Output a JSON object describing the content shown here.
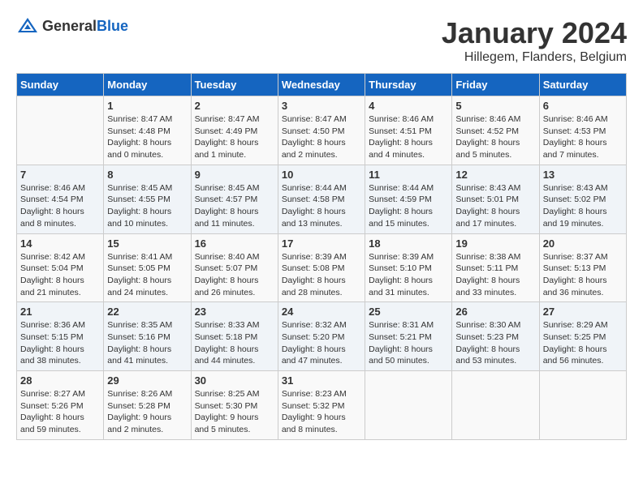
{
  "header": {
    "logo_general": "General",
    "logo_blue": "Blue",
    "title": "January 2024",
    "subtitle": "Hillegem, Flanders, Belgium"
  },
  "columns": [
    "Sunday",
    "Monday",
    "Tuesday",
    "Wednesday",
    "Thursday",
    "Friday",
    "Saturday"
  ],
  "weeks": [
    [
      {
        "day": "",
        "info": ""
      },
      {
        "day": "1",
        "info": "Sunrise: 8:47 AM\nSunset: 4:48 PM\nDaylight: 8 hours\nand 0 minutes."
      },
      {
        "day": "2",
        "info": "Sunrise: 8:47 AM\nSunset: 4:49 PM\nDaylight: 8 hours\nand 1 minute."
      },
      {
        "day": "3",
        "info": "Sunrise: 8:47 AM\nSunset: 4:50 PM\nDaylight: 8 hours\nand 2 minutes."
      },
      {
        "day": "4",
        "info": "Sunrise: 8:46 AM\nSunset: 4:51 PM\nDaylight: 8 hours\nand 4 minutes."
      },
      {
        "day": "5",
        "info": "Sunrise: 8:46 AM\nSunset: 4:52 PM\nDaylight: 8 hours\nand 5 minutes."
      },
      {
        "day": "6",
        "info": "Sunrise: 8:46 AM\nSunset: 4:53 PM\nDaylight: 8 hours\nand 7 minutes."
      }
    ],
    [
      {
        "day": "7",
        "info": "Sunrise: 8:46 AM\nSunset: 4:54 PM\nDaylight: 8 hours\nand 8 minutes."
      },
      {
        "day": "8",
        "info": "Sunrise: 8:45 AM\nSunset: 4:55 PM\nDaylight: 8 hours\nand 10 minutes."
      },
      {
        "day": "9",
        "info": "Sunrise: 8:45 AM\nSunset: 4:57 PM\nDaylight: 8 hours\nand 11 minutes."
      },
      {
        "day": "10",
        "info": "Sunrise: 8:44 AM\nSunset: 4:58 PM\nDaylight: 8 hours\nand 13 minutes."
      },
      {
        "day": "11",
        "info": "Sunrise: 8:44 AM\nSunset: 4:59 PM\nDaylight: 8 hours\nand 15 minutes."
      },
      {
        "day": "12",
        "info": "Sunrise: 8:43 AM\nSunset: 5:01 PM\nDaylight: 8 hours\nand 17 minutes."
      },
      {
        "day": "13",
        "info": "Sunrise: 8:43 AM\nSunset: 5:02 PM\nDaylight: 8 hours\nand 19 minutes."
      }
    ],
    [
      {
        "day": "14",
        "info": "Sunrise: 8:42 AM\nSunset: 5:04 PM\nDaylight: 8 hours\nand 21 minutes."
      },
      {
        "day": "15",
        "info": "Sunrise: 8:41 AM\nSunset: 5:05 PM\nDaylight: 8 hours\nand 24 minutes."
      },
      {
        "day": "16",
        "info": "Sunrise: 8:40 AM\nSunset: 5:07 PM\nDaylight: 8 hours\nand 26 minutes."
      },
      {
        "day": "17",
        "info": "Sunrise: 8:39 AM\nSunset: 5:08 PM\nDaylight: 8 hours\nand 28 minutes."
      },
      {
        "day": "18",
        "info": "Sunrise: 8:39 AM\nSunset: 5:10 PM\nDaylight: 8 hours\nand 31 minutes."
      },
      {
        "day": "19",
        "info": "Sunrise: 8:38 AM\nSunset: 5:11 PM\nDaylight: 8 hours\nand 33 minutes."
      },
      {
        "day": "20",
        "info": "Sunrise: 8:37 AM\nSunset: 5:13 PM\nDaylight: 8 hours\nand 36 minutes."
      }
    ],
    [
      {
        "day": "21",
        "info": "Sunrise: 8:36 AM\nSunset: 5:15 PM\nDaylight: 8 hours\nand 38 minutes."
      },
      {
        "day": "22",
        "info": "Sunrise: 8:35 AM\nSunset: 5:16 PM\nDaylight: 8 hours\nand 41 minutes."
      },
      {
        "day": "23",
        "info": "Sunrise: 8:33 AM\nSunset: 5:18 PM\nDaylight: 8 hours\nand 44 minutes."
      },
      {
        "day": "24",
        "info": "Sunrise: 8:32 AM\nSunset: 5:20 PM\nDaylight: 8 hours\nand 47 minutes."
      },
      {
        "day": "25",
        "info": "Sunrise: 8:31 AM\nSunset: 5:21 PM\nDaylight: 8 hours\nand 50 minutes."
      },
      {
        "day": "26",
        "info": "Sunrise: 8:30 AM\nSunset: 5:23 PM\nDaylight: 8 hours\nand 53 minutes."
      },
      {
        "day": "27",
        "info": "Sunrise: 8:29 AM\nSunset: 5:25 PM\nDaylight: 8 hours\nand 56 minutes."
      }
    ],
    [
      {
        "day": "28",
        "info": "Sunrise: 8:27 AM\nSunset: 5:26 PM\nDaylight: 8 hours\nand 59 minutes."
      },
      {
        "day": "29",
        "info": "Sunrise: 8:26 AM\nSunset: 5:28 PM\nDaylight: 9 hours\nand 2 minutes."
      },
      {
        "day": "30",
        "info": "Sunrise: 8:25 AM\nSunset: 5:30 PM\nDaylight: 9 hours\nand 5 minutes."
      },
      {
        "day": "31",
        "info": "Sunrise: 8:23 AM\nSunset: 5:32 PM\nDaylight: 9 hours\nand 8 minutes."
      },
      {
        "day": "",
        "info": ""
      },
      {
        "day": "",
        "info": ""
      },
      {
        "day": "",
        "info": ""
      }
    ]
  ]
}
